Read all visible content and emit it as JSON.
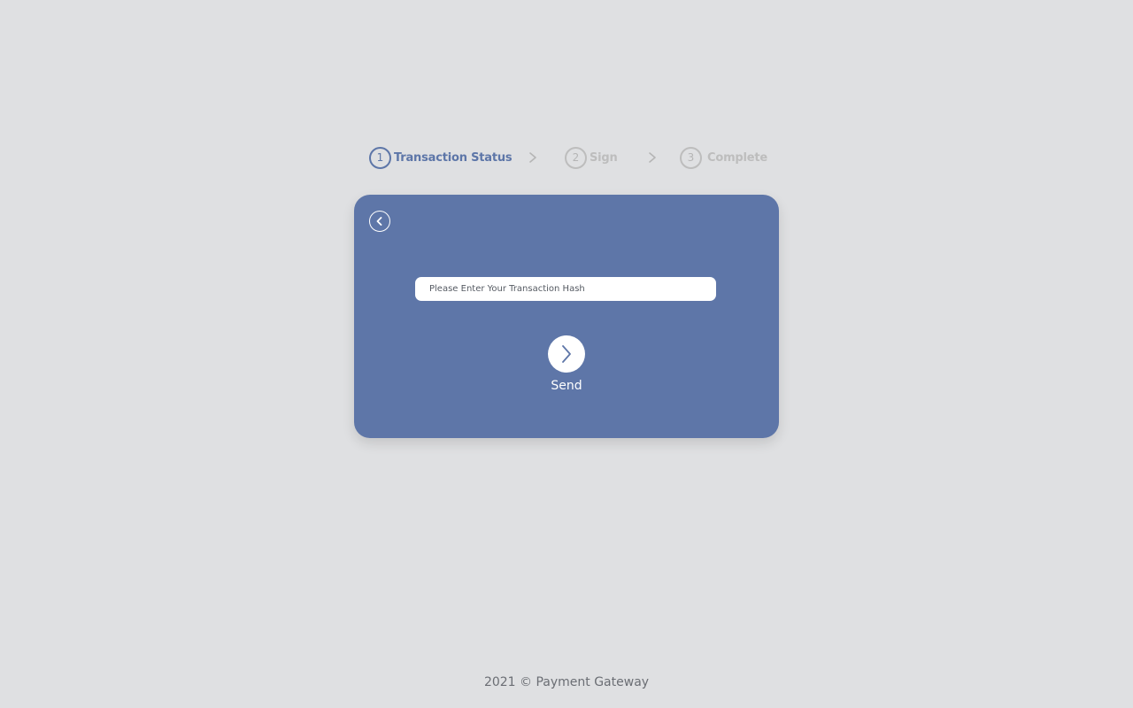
{
  "stepper": {
    "steps": [
      {
        "number": "1",
        "label": "Transaction Status",
        "active": true
      },
      {
        "number": "2",
        "label": "Sign",
        "active": false
      },
      {
        "number": "3",
        "label": "Complete",
        "active": false
      }
    ],
    "separator_icon": "chevron-right-icon"
  },
  "card": {
    "back_icon": "chevron-left-icon",
    "input": {
      "placeholder": "Please Enter Your Transaction Hash",
      "value": ""
    },
    "send": {
      "icon": "chevron-right-icon",
      "label": "Send"
    }
  },
  "footer": {
    "text": "2021 © Payment Gateway"
  },
  "colors": {
    "background": "#dfe0e2",
    "accent": "#5e76a8",
    "inactive": "#bdbdbd"
  }
}
